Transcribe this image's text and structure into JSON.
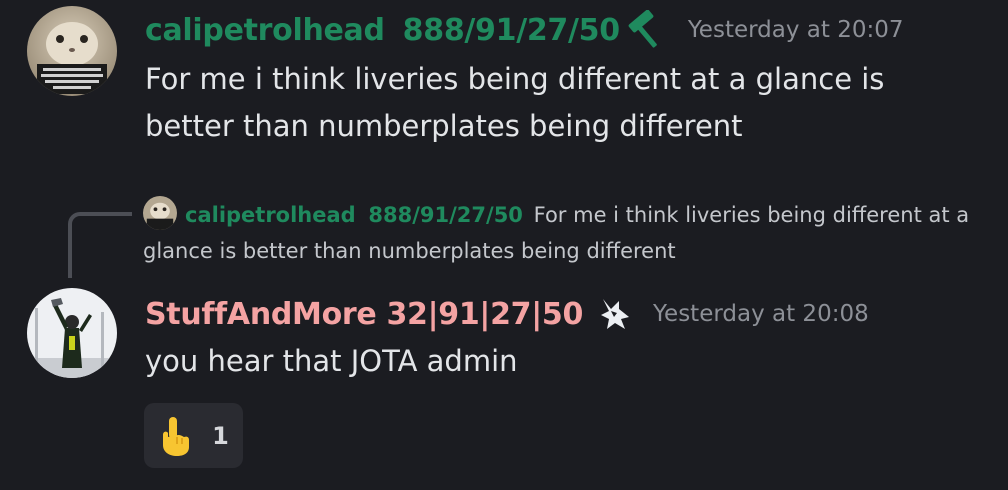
{
  "colors": {
    "background": "#1b1c21",
    "user1_name": "#1f8a5e",
    "user2_name": "#f4a3a3",
    "timestamp": "#8d9097",
    "reply_line": "#4c4e55",
    "reaction_bg": "#2a2b31"
  },
  "message1": {
    "author": "calipetrolhead",
    "tag": "888/91/27/50",
    "badge_icon": "hammer-icon",
    "timestamp": "Yesterday at 20:07",
    "text": "For me i think liveries being different at a glance  is better than numberplates being different",
    "avatar_icon": "cat-avatar-icon"
  },
  "reply": {
    "author": "calipetrolhead",
    "tag": "888/91/27/50",
    "text": "For me i think liveries being different at a glance  is better than numberplates being different"
  },
  "message2": {
    "author": "StuffAndMore",
    "tag": "32|91|27|50",
    "badge_icon": "wolf-icon",
    "timestamp": "Yesterday at 20:08",
    "text": "you hear that JOTA admin",
    "avatar_icon": "racer-avatar-icon"
  },
  "reactions": [
    {
      "emoji": "👆",
      "emoji_icon": "pointing-up-hand-icon",
      "count": "1"
    }
  ]
}
